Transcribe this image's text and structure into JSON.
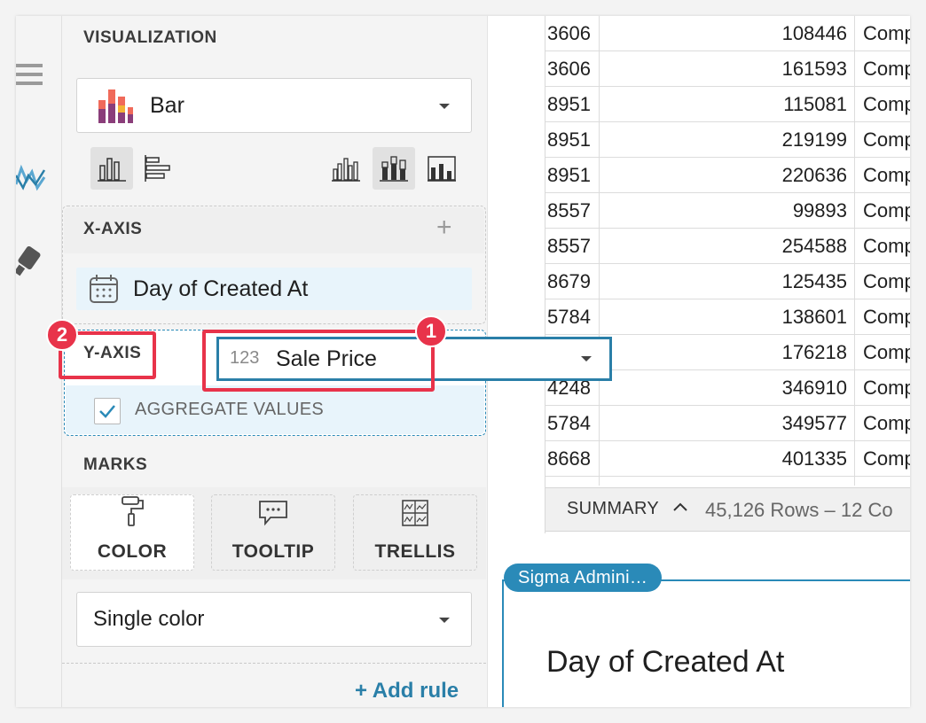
{
  "panel": {
    "visualization_title": "VISUALIZATION",
    "chart_type": "Bar",
    "xaxis_title": "X-AXIS",
    "xaxis_add": "+",
    "xaxis_field": "Day of Created At",
    "yaxis_title": "Y-AXIS",
    "aggregate_label": "AGGREGATE VALUES",
    "marks_title": "MARKS",
    "marks_tabs": [
      "COLOR",
      "TOOLTIP",
      "TRELLIS"
    ],
    "color_select": "Single color",
    "add_rule": "+ Add rule"
  },
  "drag": {
    "type_glyph": "123",
    "field_name": "Sale Price"
  },
  "annotations": {
    "badge_1": "1",
    "badge_2": "2"
  },
  "table": {
    "rows": [
      [
        "3606",
        "108446",
        "Comp"
      ],
      [
        "3606",
        "161593",
        "Comp"
      ],
      [
        "8951",
        "115081",
        "Comp"
      ],
      [
        "8951",
        "219199",
        "Comp"
      ],
      [
        "8951",
        "220636",
        "Comp"
      ],
      [
        "8557",
        "99893",
        "Comp"
      ],
      [
        "8557",
        "254588",
        "Comp"
      ],
      [
        "8679",
        "125435",
        "Comp"
      ],
      [
        "5784",
        "138601",
        "Comp"
      ],
      [
        "",
        "176218",
        "Comp"
      ],
      [
        "4248",
        "346910",
        "Comp"
      ],
      [
        "5784",
        "349577",
        "Comp"
      ],
      [
        "8668",
        "401335",
        "Comp"
      ]
    ],
    "summary_label": "SUMMARY",
    "summary_caret": "^",
    "summary_counts": "45,126 Rows – 12 Co"
  },
  "card": {
    "tag": "Sigma Admini…",
    "title": "Day of Created At"
  },
  "colors": {
    "accent": "#2a8ab8",
    "annotation_red": "#e8334a",
    "chip_bg": "#e8f4fb"
  }
}
